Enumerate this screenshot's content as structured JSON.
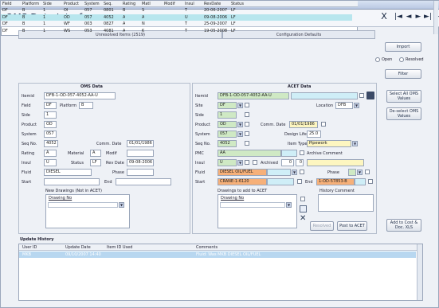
{
  "window": {
    "title": "OMS Browser"
  },
  "header": {
    "title": "OMS Data Interface",
    "close": "X",
    "nav": [
      "|◄",
      "◄",
      "►",
      "►|",
      "▷"
    ]
  },
  "tabs": [
    "Unresolved Items (2519)",
    "Configuration Defaults"
  ],
  "grid": {
    "columns": [
      "Field",
      "Platform",
      "Side",
      "Product",
      "System",
      "Seq.",
      "Rating",
      "Matl",
      "Modif",
      "Insul",
      "RevDate",
      "Status"
    ],
    "rows": [
      [
        "DF",
        "B",
        "1",
        "OI",
        "057",
        "0801",
        "B",
        "S",
        "",
        "T",
        "20-06-2007",
        "LF"
      ],
      [
        "DF",
        "B",
        "1",
        "OD",
        "057",
        "4052",
        "A",
        "A",
        "",
        "U",
        "09-08-2006",
        "LF"
      ],
      [
        "DF",
        "B",
        "1",
        "WF",
        "003",
        "0827",
        "A",
        "N",
        "",
        "T",
        "25-09-2007",
        "LF"
      ],
      [
        "DF",
        "B",
        "1",
        "WS",
        "053",
        "4081",
        "A",
        "K",
        "",
        "T",
        "19-05-2008",
        "LF"
      ]
    ]
  },
  "right_buttons": {
    "import": "Import",
    "filter": "Filter",
    "open": "Open",
    "resolved": "Resolved"
  },
  "oms": {
    "heading": "OMS Data",
    "itemid_label": "Itemid",
    "itemid": "DFB-1-OD-057-4052-AA-U",
    "field_label": "Field",
    "field": "DF",
    "platform_label": "Platform",
    "platform": "B",
    "side_label": "Side",
    "side": "1",
    "product_label": "Product",
    "product": "OD",
    "system_label": "System",
    "system": "057",
    "seq_label": "Seq No.",
    "seq": "4052",
    "commdate_label": "Comm. Date",
    "commdate": "01/01/1986",
    "rating_label": "Rating",
    "rating": "A",
    "material_label": "Material",
    "material": "A",
    "modif_label": "Modif",
    "modif": "",
    "insul_label": "Insul",
    "insul": "U",
    "status_label": "Status",
    "status": "LF",
    "revdate_label": "Rev Date",
    "revdate": "09-08-2006",
    "fluid_label": "Fluid",
    "fluid": "DIESEL",
    "phase_label": "Phase",
    "phase": "",
    "start_label": "Start",
    "start": "",
    "end_label": "End",
    "end": "",
    "drawings_label": "New Drawings (Not in ACET)",
    "drawing_col": "Drawing No"
  },
  "acet": {
    "heading": "ACET Data",
    "itemid_label": "Itemid",
    "itemid": "DFB-1-OD-057-4052-AA-U",
    "site_label": "Site",
    "site": "DF",
    "location_label": "Location",
    "location": "DFB",
    "side_label": "Side",
    "side": "1",
    "product_label": "Product",
    "product": "OD",
    "commdate_label": "Comm. Date",
    "commdate": "01/01/1986",
    "system_label": "System",
    "system": "057",
    "design_label": "Design Life",
    "design": "25.0",
    "seq_label": "Seq No.",
    "seq": "4052",
    "itemtype_label": "Item Type",
    "itemtype": "Pipework",
    "pmc_label": "PMC",
    "pmc": "AA",
    "archive_label": "Archive Comment",
    "insul_label": "Insul",
    "insul": "U",
    "archived_label": "Archived",
    "archived": "0",
    "archived2": "0",
    "fluid_label": "Fluid",
    "fluid": "DIESEL OIL/FUEL",
    "phase_label": "Phase",
    "phase": "",
    "start_label": "Start",
    "start": "CRANE-1-6120",
    "end_label": "End",
    "end": "1-OD-57853-B",
    "drawings_label": "Drawings to add to ACET",
    "drawing_col": "Drawing No",
    "history_label": "History Comment"
  },
  "buttons": {
    "select_all": "Select All OMS Values",
    "deselect": "De-select OMS Values",
    "resolved": "Resolved",
    "post": "Post to ACET",
    "add_cost": "Add to Cost & Doc. XLS"
  },
  "update": {
    "heading": "Update History",
    "columns": [
      "User ID",
      "Update Date",
      "Item ID Used",
      "Comments"
    ],
    "row": [
      "MKB",
      "09/10/2007 14:40",
      "",
      "Fluid: Was MKB DIESEL OIL/FUEL"
    ]
  },
  "colors": {
    "accent": "#b9c8e3",
    "highlight": "#b8d7f0",
    "green": "#cfe9c4",
    "yellow": "#fdf6c0",
    "orange": "#f6b079"
  }
}
